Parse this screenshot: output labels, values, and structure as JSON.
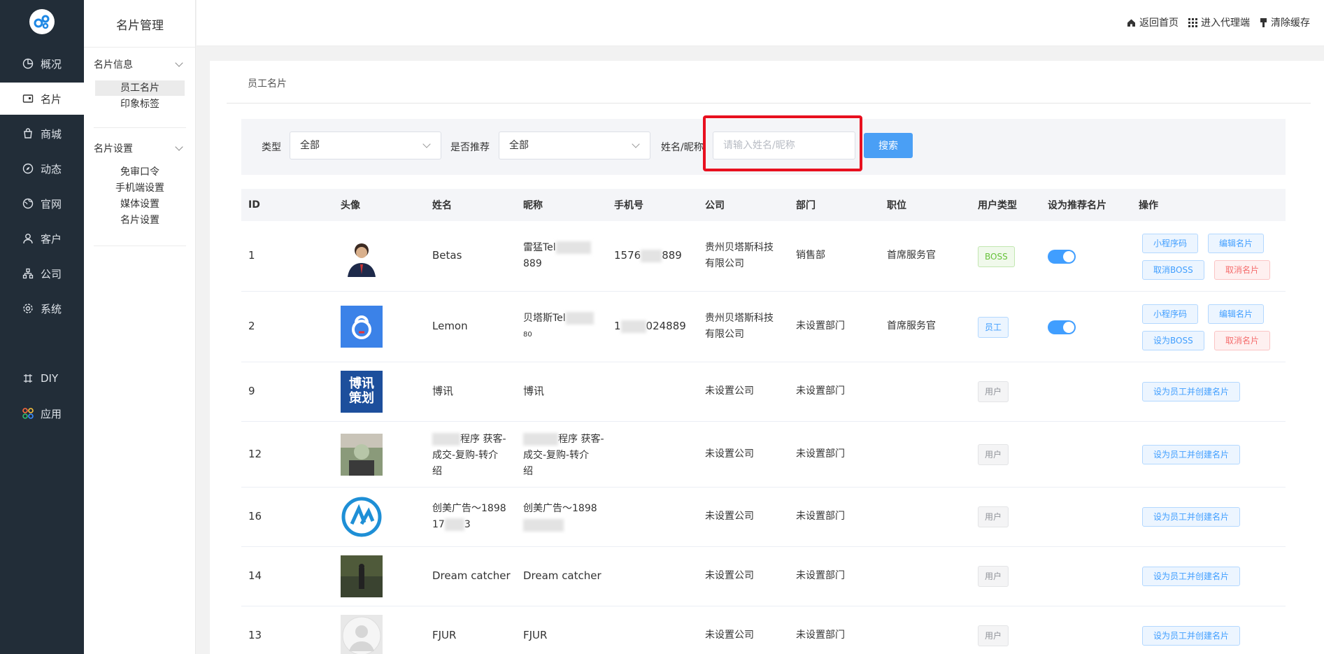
{
  "nav": {
    "items": [
      {
        "label": "概况",
        "icon": "pie-chart-icon"
      },
      {
        "label": "名片",
        "icon": "card-icon"
      },
      {
        "label": "商城",
        "icon": "shop-icon"
      },
      {
        "label": "动态",
        "icon": "compass-icon"
      },
      {
        "label": "官网",
        "icon": "globe-icon"
      },
      {
        "label": "客户",
        "icon": "user-icon"
      },
      {
        "label": "公司",
        "icon": "org-icon"
      },
      {
        "label": "系统",
        "icon": "gear-icon"
      },
      {
        "label": "DIY",
        "icon": "diy-icon"
      },
      {
        "label": "应用",
        "icon": "apps-icon"
      }
    ]
  },
  "subnav": {
    "title": "名片管理",
    "group1": "名片信息",
    "group1_links": [
      "员工名片",
      "印象标签"
    ],
    "group2": "名片设置",
    "group2_links": [
      "免审口令",
      "手机端设置",
      "媒体设置",
      "名片设置"
    ]
  },
  "header": {
    "home": "返回首页",
    "agent": "进入代理端",
    "cache": "清除缓存"
  },
  "page": {
    "crumb": "员工名片"
  },
  "filter": {
    "type_label": "类型",
    "type_value": "全部",
    "recommend_label": "是否推荐",
    "recommend_value": "全部",
    "name_label": "姓名/昵称",
    "name_placeholder": "请输入姓名/昵称",
    "search": "搜索"
  },
  "table": {
    "headers": [
      "ID",
      "头像",
      "姓名",
      "昵称",
      "手机号",
      "公司",
      "部门",
      "职位",
      "用户类型",
      "设为推荐名片",
      "操作"
    ],
    "rows": [
      {
        "id": "1",
        "name": "Betas",
        "nick1": "雷猛Tel",
        "nick2": "889",
        "phone_a": "1576",
        "phone_b": "889",
        "company1": "贵州贝塔斯科技",
        "company2": "有限公司",
        "dept": "销售部",
        "position": "首席服务官",
        "type": "BOSS",
        "ops": [
          "小程序码",
          "编辑名片",
          "取消BOSS",
          "取消名片"
        ]
      },
      {
        "id": "2",
        "name": "Lemon",
        "nick1": "贝塔斯Tel",
        "nick2": "80",
        "phone_a": "1",
        "phone_b": "024889",
        "company1": "贵州贝塔斯科技",
        "company2": "有限公司",
        "dept": "未设置部门",
        "position": "首席服务官",
        "type": "员工",
        "ops": [
          "小程序码",
          "编辑名片",
          "设为BOSS",
          "取消名片"
        ]
      },
      {
        "id": "9",
        "name": "博讯",
        "nick": "博讯",
        "company": "未设置公司",
        "dept": "未设置部门",
        "type": "用户",
        "op": "设为员工并创建名片"
      },
      {
        "id": "12",
        "name1": "程序 获客-",
        "name2": "成交-复购-转介",
        "name3": "绍",
        "nick1": "程序 获客-",
        "nick2": "成交-复购-转介",
        "nick3": "绍",
        "company": "未设置公司",
        "dept": "未设置部门",
        "type": "用户",
        "op": "设为员工并创建名片"
      },
      {
        "id": "16",
        "name1": "创美广告～1898",
        "name2a": "17",
        "name2b": "3",
        "nick1": "创美广告～1898",
        "company": "未设置公司",
        "dept": "未设置部门",
        "type": "用户",
        "op": "设为员工并创建名片"
      },
      {
        "id": "14",
        "name": "Dream catcher",
        "nick": "Dream catcher",
        "company": "未设置公司",
        "dept": "未设置部门",
        "type": "用户",
        "op": "设为员工并创建名片"
      },
      {
        "id": "13",
        "name": "FJUR",
        "nick": "FJUR",
        "company": "未设置公司",
        "dept": "未设置部门",
        "type": "用户",
        "op": "设为员工并创建名片"
      }
    ]
  },
  "avatar_text": {
    "boxun_line1": "博讯",
    "boxun_line2": "策划"
  },
  "colors": {
    "sidebar": "#222d38",
    "primary": "#4a9ff5",
    "highlight": "#e8101f"
  }
}
